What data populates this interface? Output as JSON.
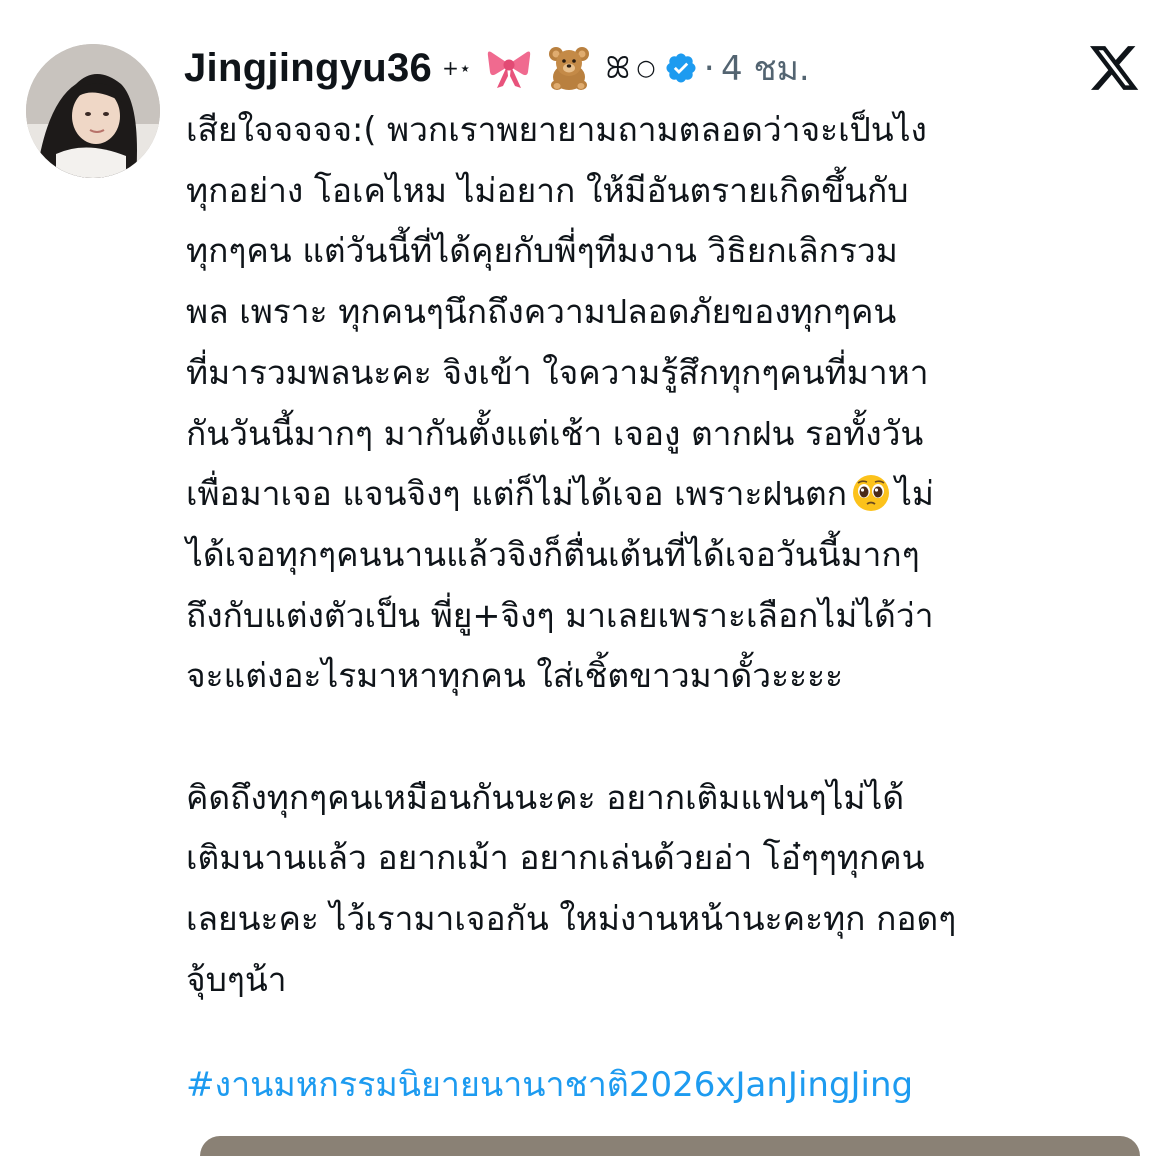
{
  "post": {
    "author": {
      "display_name": "Jingjingyu36",
      "name_decor": {
        "sparkle": "+⋆",
        "emoji_1": "ribbon-emoji",
        "emoji_2": "teddy-bear-emoji",
        "swirl": "ꕤ",
        "ring": "○"
      },
      "verified": true
    },
    "separator": "·",
    "time": "4 ชม.",
    "platform_logo": "x-logo",
    "body": {
      "paragraph_1": {
        "line_1": "เสียใจจจจจ:( พวกเราพยายามถามตลอดว่าจะเป็นไง",
        "line_2": "ทุกอย่าง โอเคไหม ไม่อยาก ให้มีอันตรายเกิดขึ้นกับ",
        "line_3": "ทุกๆคน แต่วันนี้ที่ได้คุยกับพี่ๆทีมงาน วิธิยกเลิกรวม",
        "line_4": "พล เพราะ ทุกคนๆนึกถึงความปลอดภัยของทุกๆคน",
        "line_5": "ที่มารวมพลนะคะ จิงเข้า ใจความรู้สึกทุกๆคนที่มาหา",
        "line_6": "กันวันนี้มากๆ มากันตั้งแต่เช้า เจองู ตากฝน รอทั้งวัน",
        "line_7a": "เพื่อมาเจอ แจนจิงๆ แต่ก็ไม่ได้เจอ เพราะฝนตก",
        "line_7_emoji": "pleading-face-emoji",
        "line_7b": "ไม่",
        "line_8": "ได้เจอทุกๆคนนานแล้วจิงก็ตื่นเต้นที่ได้เจอวันนี้มากๆ",
        "line_9": "ถึงกับแต่งตัวเป็น พี่ยู+จิงๆ มาเลยเพราะเลือกไม่ได้ว่า",
        "line_10": "จะแต่งอะไรมาหาทุกคน  ใส่เชิ้ตขาวมาดั้วะะะะ"
      },
      "paragraph_2": {
        "line_1": "คิดถึงทุกๆคนเหมือนกันนะคะ อยากเติมแฟนๆไม่ได้",
        "line_2": "เติมนานแล้ว อยากเม้า อยากเล่นด้วยอ่า  โอ๋ๆๆทุกคน",
        "line_3": "เลยนะคะ ไว้เรามาเจอกัน ใหม่งานหน้านะคะทุก กอดๆ",
        "line_4": "จุ้บๆน้า"
      },
      "hashtag": "#งานมหกรรมนิยายนานาชาติ2026xJanJingJing"
    },
    "colors": {
      "text": "#0f1419",
      "secondary_text": "#536471",
      "link": "#1d9bf0",
      "verified_badge": "#1d9bf0"
    },
    "icons": {
      "avatar": "avatar",
      "verified": "verified-badge-icon"
    }
  }
}
